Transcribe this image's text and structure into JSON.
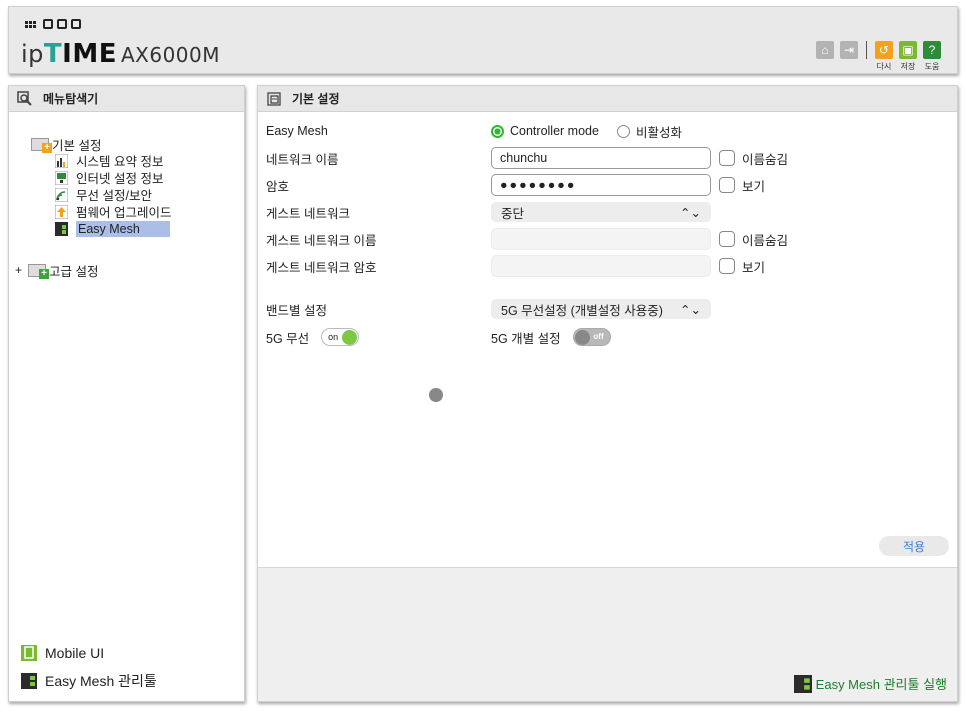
{
  "header": {
    "model": "AX6000M",
    "buttons": {
      "reset": "다시",
      "save": "저장",
      "help": "도움"
    }
  },
  "left": {
    "title": "메뉴탐색기",
    "basic_group": "기본 설정",
    "items": [
      "시스템 요약 정보",
      "인터넷 설정 정보",
      "무선 설정/보안",
      "펌웨어 업그레이드",
      "Easy Mesh"
    ],
    "advanced_group": "고급 설정",
    "mobile_ui": "Mobile UI",
    "mesh_tool": "Easy Mesh 관리툴"
  },
  "right": {
    "title": "기본 설정",
    "labels": {
      "easy_mesh": "Easy Mesh",
      "network_name": "네트워크 이름",
      "password": "암호",
      "guest_network": "게스트 네트워크",
      "guest_network_name": "게스트 네트워크 이름",
      "guest_network_password": "게스트 네트워크 암호",
      "band_setting": "밴드별 설정",
      "wifi_5g": "5G 무선",
      "individual_5g": "5G 개별 설정"
    },
    "radio": {
      "controller": "Controller mode",
      "disable": "비활성화"
    },
    "network_name_value": "chunchu",
    "password_value": "●●●●●●●●",
    "hide_name": "이름숨김",
    "show": "보기",
    "guest_select": "중단",
    "band_select": "5G 무선설정 (개별설정 사용중)",
    "toggle_on": "on",
    "toggle_off": "off",
    "apply": "적용",
    "footer_link": "Easy Mesh 관리툴 실행"
  }
}
